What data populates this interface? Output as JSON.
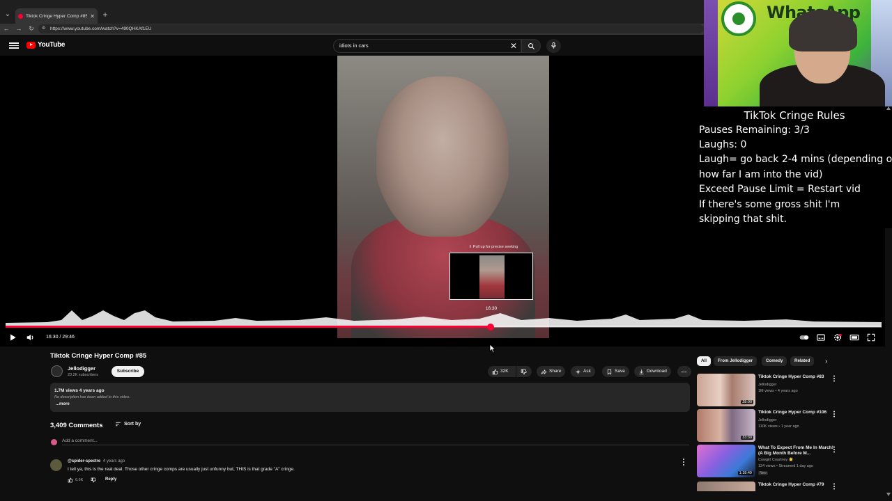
{
  "browser": {
    "tab_title": "Tiktok Cringe Hyper Comp #85 - YouTube",
    "url": "https://www.youtube.com/watch?v=490QHKAf1EU"
  },
  "header": {
    "logo_text": "YouTube",
    "search_value": "idiots in cars"
  },
  "player": {
    "seek_hint": "⇳ Pull up for precise seeking",
    "seek_preview_time": "16:30",
    "time_display": "16:30 / 29:46",
    "progress": 0.554
  },
  "overlay": {
    "webcam_brand": "WhatsApp",
    "rules_title": "TikTok Cringe Rules",
    "rules_lines": [
      "Pauses Remaining: 3/3",
      "Laughs: 0",
      "Laugh= go back 2-4 mins (depending on",
      "how far I am into the vid)",
      "Exceed Pause Limit = Restart vid",
      "If there's some gross shit I'm",
      "skipping that shit."
    ]
  },
  "video": {
    "title": "Tiktok Cringe Hyper Comp #85",
    "channel_name": "Jellodigger",
    "channel_subs": "23.2K subscribers",
    "subscribe_label": "Subscribe",
    "likes": "32K",
    "share_label": "Share",
    "ask_label": "Ask",
    "save_label": "Save",
    "download_label": "Download",
    "meta": "1.7M views  4 years ago",
    "description": "No description has been added to this video.",
    "more_label": "...more"
  },
  "comments": {
    "count_label": "3,409 Comments",
    "sort_label": "Sort by",
    "add_placeholder": "Add a comment...",
    "items": [
      {
        "author": "@spider-spectre",
        "ago": "4 years ago",
        "text": "I tell ya, this is the real deal. Those other cringe comps are usually just unfunny but, THIS is that grade \"A\" cringe.",
        "likes": "6.6K",
        "reply_label": "Reply"
      }
    ]
  },
  "sidebar": {
    "chips": [
      "All",
      "From Jellodigger",
      "Comedy",
      "Related"
    ],
    "recommendations": [
      {
        "title": "Tiktok Cringe Hyper Comp #83",
        "channel": "Jellodigger",
        "meta": "1M views • 4 years ago",
        "duration": "28:00",
        "new": ""
      },
      {
        "title": "Tiktok Cringe Hyper Comp #106",
        "channel": "Jellodigger",
        "meta": "110K views • 1 year ago",
        "duration": "33:30",
        "new": ""
      },
      {
        "title": "What To Expect From Me In March! (A Big Month Before M...",
        "channel": "Cowgirl Courtney ⭐",
        "meta": "134 views • Streamed 1 day ago",
        "duration": "1:18:49",
        "new": "New"
      },
      {
        "title": "Tiktok Cringe Hyper Comp #79",
        "channel": "",
        "meta": "",
        "duration": "",
        "new": ""
      }
    ]
  },
  "colors": {
    "accent": "#ff0033",
    "background": "#0f0f0f",
    "surface": "#272727"
  }
}
